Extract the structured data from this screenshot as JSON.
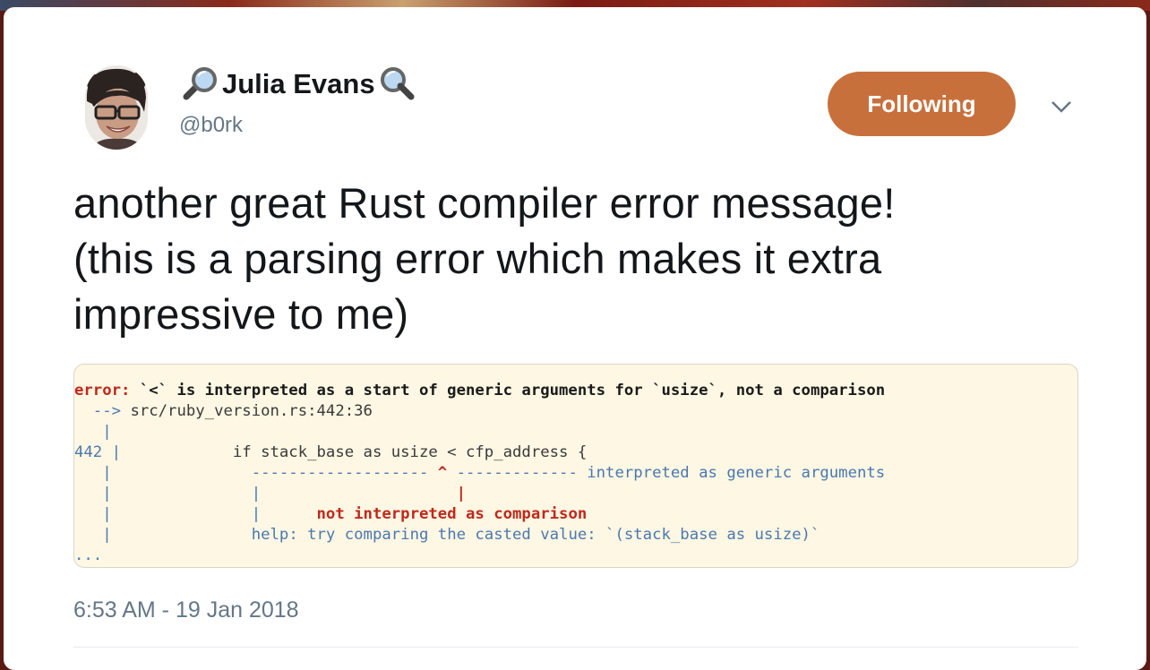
{
  "author": {
    "name": "Julia Evans",
    "handle": "@b0rk",
    "left_icon": "magnifying-glass-left-icon",
    "right_icon": "magnifying-glass-right-icon"
  },
  "follow_button": {
    "label": "Following",
    "color": "#c8703c"
  },
  "menu_icon": "chevron-down-icon",
  "tweet": {
    "lines": [
      "another great Rust compiler error message!",
      "(this is a parsing error which makes it extra",
      "impressive to me)"
    ]
  },
  "code_image": {
    "error_keyword": "error:",
    "error_message": " `<` is interpreted as a start of generic arguments for `usize`, not a comparison",
    "arrow": "  --> ",
    "location": "src/ruby_version.rs:442:36",
    "gutter_bar": "   |",
    "line_number": "442",
    "line_sep": " |",
    "source_line": "            if stack_base as usize < cfp_address {",
    "underline_left": "               ------------------- ",
    "caret": "^",
    "underline_right": " ------------- interpreted as generic arguments",
    "pipe_left": "               |",
    "pipe_right": "                     |",
    "not_interpreted": "not interpreted as comparison",
    "help_prefix": "               ",
    "help": "help: try comparing the casted value: `(stack_base as usize)`",
    "ellipsis": "..."
  },
  "timestamp": "6:53 AM - 19 Jan 2018"
}
